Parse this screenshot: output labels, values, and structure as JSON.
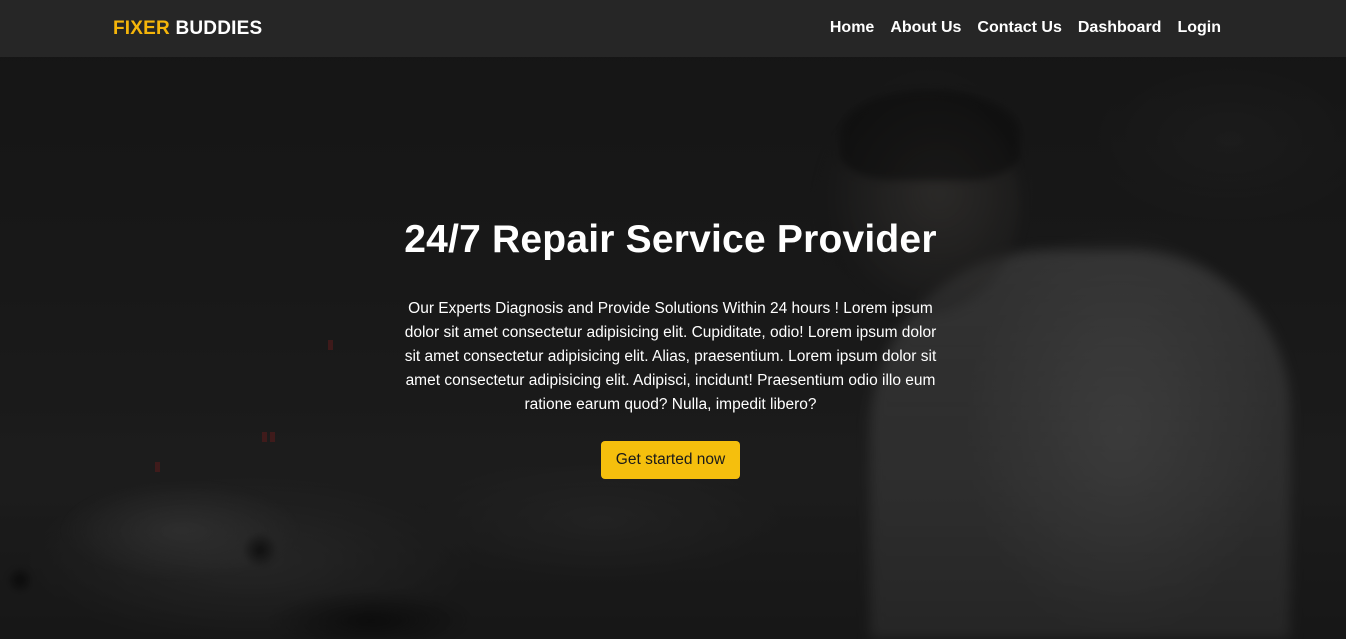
{
  "brand": {
    "accent": "FIXER",
    "rest": "BUDDIES",
    "accent_color": "#f5b50a"
  },
  "nav": {
    "items": [
      {
        "label": "Home"
      },
      {
        "label": "About Us"
      },
      {
        "label": "Contact Us"
      },
      {
        "label": "Dashboard"
      },
      {
        "label": "Login"
      }
    ]
  },
  "hero": {
    "title": "24/7 Repair Service Provider",
    "description": "Our Experts Diagnosis and Provide Solutions Within 24 hours ! Lorem ipsum dolor sit amet consectetur adipisicing elit. Cupiditate, odio! Lorem ipsum dolor sit amet consectetur adipisicing elit. Alias, praesentium. Lorem ipsum dolor sit amet consectetur adipisicing elit. Adipisci, incidunt! Praesentium odio illo eum ratione earum quod? Nulla, impedit libero?",
    "cta_label": "Get started now",
    "cta_color": "#f5bf0d"
  }
}
